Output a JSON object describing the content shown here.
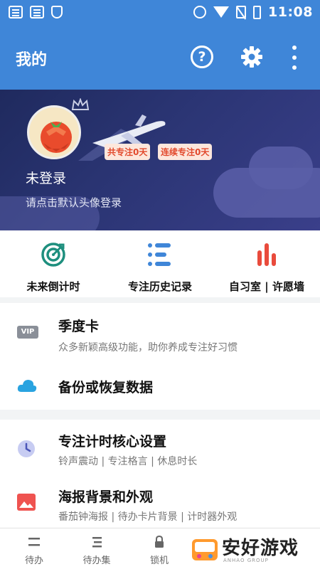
{
  "status_bar": {
    "time": "11:08"
  },
  "header": {
    "title": "我的",
    "help_glyph": "?"
  },
  "profile": {
    "chip_total": "共专注0天",
    "chip_streak": "连续专注0天",
    "login_title": "未登录",
    "login_hint": "请点击默认头像登录"
  },
  "quick_actions": [
    {
      "label": "未来倒计时",
      "icon": "target-icon"
    },
    {
      "label": "专注历史记录",
      "icon": "list-icon"
    },
    {
      "label": "自习室 | 许愿墙",
      "icon": "bar-chart-icon"
    }
  ],
  "menu": {
    "season_card": {
      "badge": "VIP",
      "title": "季度卡",
      "subtitle": "众多新颖高级功能，助你养成专注好习惯"
    },
    "backup": {
      "title": "备份或恢复数据"
    },
    "core_settings": {
      "title": "专注计时核心设置",
      "subtitle": "铃声震动 | 专注格言 | 休息时长"
    },
    "poster": {
      "title": "海报背景和外观",
      "subtitle": "番茄钟海报 | 待办卡片背景 | 计时器外观"
    }
  },
  "tabs": [
    {
      "label": "待办"
    },
    {
      "label": "待办集"
    },
    {
      "label": "锁机"
    }
  ],
  "watermark": {
    "text": "安好游戏",
    "small": "ANHAO GROUP"
  },
  "colors": {
    "primary": "#3f86d8",
    "accent_red": "#e2492c",
    "teal": "#1e8f7e"
  }
}
